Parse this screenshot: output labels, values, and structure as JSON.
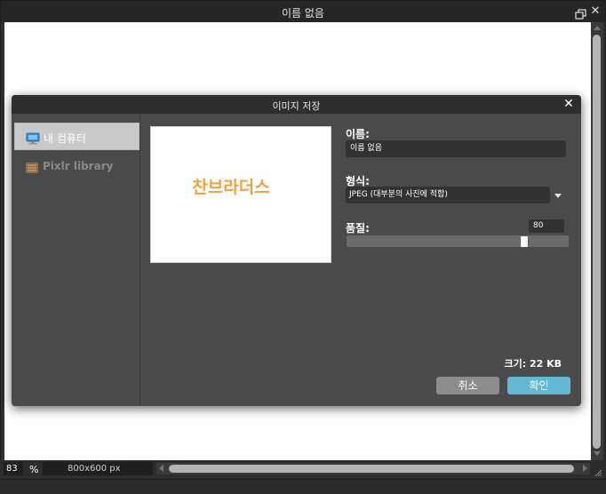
{
  "window": {
    "title": "이름 없음",
    "restore_icon": "restore-window-icon",
    "close_icon": "close-icon"
  },
  "status": {
    "zoom": "83",
    "zoom_unit": "%",
    "document_size": "800x600 px"
  },
  "dialog": {
    "title": "이미지 저장",
    "close_label": "✕",
    "sidebar": [
      {
        "label": "내 컴퓨터",
        "icon": "computer-icon",
        "active": true
      },
      {
        "label": "Pixlr library",
        "icon": "library-icon",
        "active": false
      }
    ],
    "preview_text": "찬브라더스",
    "name_label": "이름:",
    "name_value": "이름 없음",
    "format_label": "형식:",
    "format_value": "JPEG (대부분의 사진에 적합)",
    "quality_label": "품질:",
    "quality_value": "80",
    "quality_level": 0.8,
    "size_text": "크기: 22 KB",
    "cancel_label": "취소",
    "ok_label": "확인"
  },
  "colors": {
    "accent": "#61b9d3",
    "preview_text": "#f0a040",
    "dialog_bg": "#4a4a4a"
  }
}
